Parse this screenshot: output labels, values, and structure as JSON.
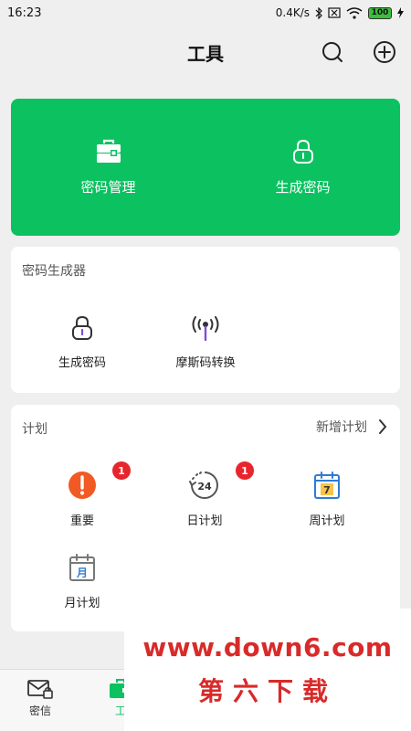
{
  "status_bar": {
    "time": "16:23",
    "net_speed": "0.4K/s",
    "battery": "100"
  },
  "header": {
    "title": "工具"
  },
  "hero": {
    "items": [
      {
        "label": "密码管理"
      },
      {
        "label": "生成密码"
      }
    ]
  },
  "generator_card": {
    "title": "密码生成器",
    "items": [
      {
        "label": "生成密码"
      },
      {
        "label": "摩斯码转换"
      }
    ]
  },
  "plan_card": {
    "title": "计划",
    "link_label": "新增计划",
    "items": [
      {
        "label": "重要",
        "badge": "1"
      },
      {
        "label": "日计划",
        "badge": "1",
        "icon_text": "24"
      },
      {
        "label": "周计划",
        "icon_text": "7"
      },
      {
        "label": "月计划",
        "icon_text": "月"
      }
    ]
  },
  "tab_bar": {
    "tabs": [
      {
        "label": "密信"
      },
      {
        "label": "工"
      }
    ]
  },
  "watermark": {
    "url": "www.down6.com",
    "name": "第六下载"
  },
  "colors": {
    "accent": "#0bc160",
    "badge": "#e8252c",
    "important": "#f15a24",
    "watermark": "#d92a2a"
  }
}
